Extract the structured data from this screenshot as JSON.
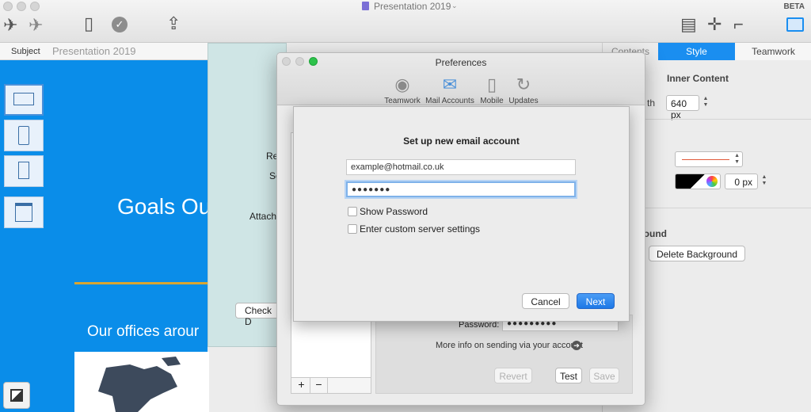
{
  "window": {
    "title": "Presentation 2019",
    "beta_badge": "BETA"
  },
  "subject": {
    "label": "Subject",
    "value": "Presentation 2019"
  },
  "slide": {
    "heading": "Goals Ou",
    "subheading": "Our offices arour"
  },
  "back_panel": {
    "label_1": "Re",
    "label_2": "Se",
    "label_3": "Attach",
    "check_button": "Check D"
  },
  "inspector": {
    "tabs": [
      "Contents",
      "Style",
      "Teamwork"
    ],
    "inner_content_label": "Inner Content",
    "width_suffix": "th",
    "width_value": "640 px",
    "border_value": "0 px",
    "background_label": "round",
    "delete_background": "Delete Background",
    "accent_color": "#1a8ef0"
  },
  "preferences": {
    "title": "Preferences",
    "tabs": [
      "Teamwork",
      "Mail Accounts",
      "Mobile",
      "Updates"
    ],
    "active_tab": "Mail Accounts",
    "password_label": "Password:",
    "password_value": "●●●●●●●●●",
    "more_info": "More info on sending via your account",
    "revert_button": "Revert",
    "test_button": "Test",
    "save_button": "Save"
  },
  "sheet": {
    "title": "Set up new email account",
    "email_value": "example@hotmail.co.uk",
    "password_value": "●●●●●●●",
    "show_password": "Show Password",
    "custom_server": "Enter custom server settings",
    "cancel_button": "Cancel",
    "next_button": "Next"
  }
}
